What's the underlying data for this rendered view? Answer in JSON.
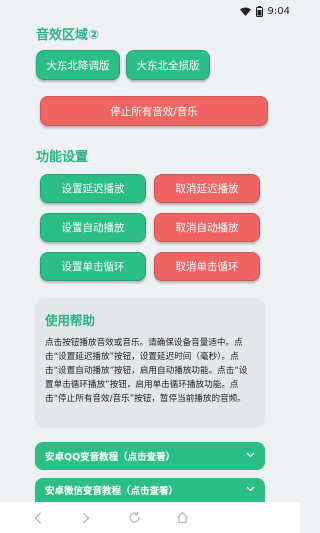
{
  "status": {
    "time": "9:04"
  },
  "sound_section": {
    "title": "音效区域②",
    "buttons": [
      "大东北降调版",
      "大东北全损版"
    ],
    "stop_all": "停止所有音效/音乐"
  },
  "settings": {
    "title": "功能设置",
    "rows": [
      {
        "set": "设置延迟播放",
        "cancel": "取消延迟播放"
      },
      {
        "set": "设置自动播放",
        "cancel": "取消自动播放"
      },
      {
        "set": "设置单击循环",
        "cancel": "取消单击循环"
      }
    ]
  },
  "help": {
    "title": "使用帮助",
    "text": "点击按钮播放音效或音乐。请确保设备音量适中。点击“设置延迟播放”按钮，设置延迟时间（毫秒）。点击“设置自动播放”按钮，启用自动播放功能。点击“设置单击循环播放”按钮，启用单击循环播放功能。点击“停止所有音效/音乐”按钮，暂停当前播放的音频。"
  },
  "tutorials": [
    {
      "label": "安卓QQ变音教程（点击查看）"
    },
    {
      "label": "安卓微信变音教程（点击查看）"
    }
  ],
  "colors": {
    "green": "#2bbf86",
    "red": "#f06464",
    "title_green": "#2bb47f"
  },
  "icons": {
    "wifi": "wifi-icon",
    "battery": "battery-icon",
    "back": "back-arrow-icon",
    "forward": "forward-arrow-icon",
    "refresh": "refresh-icon",
    "home": "home-icon",
    "chevron": "chevron-down-icon"
  }
}
